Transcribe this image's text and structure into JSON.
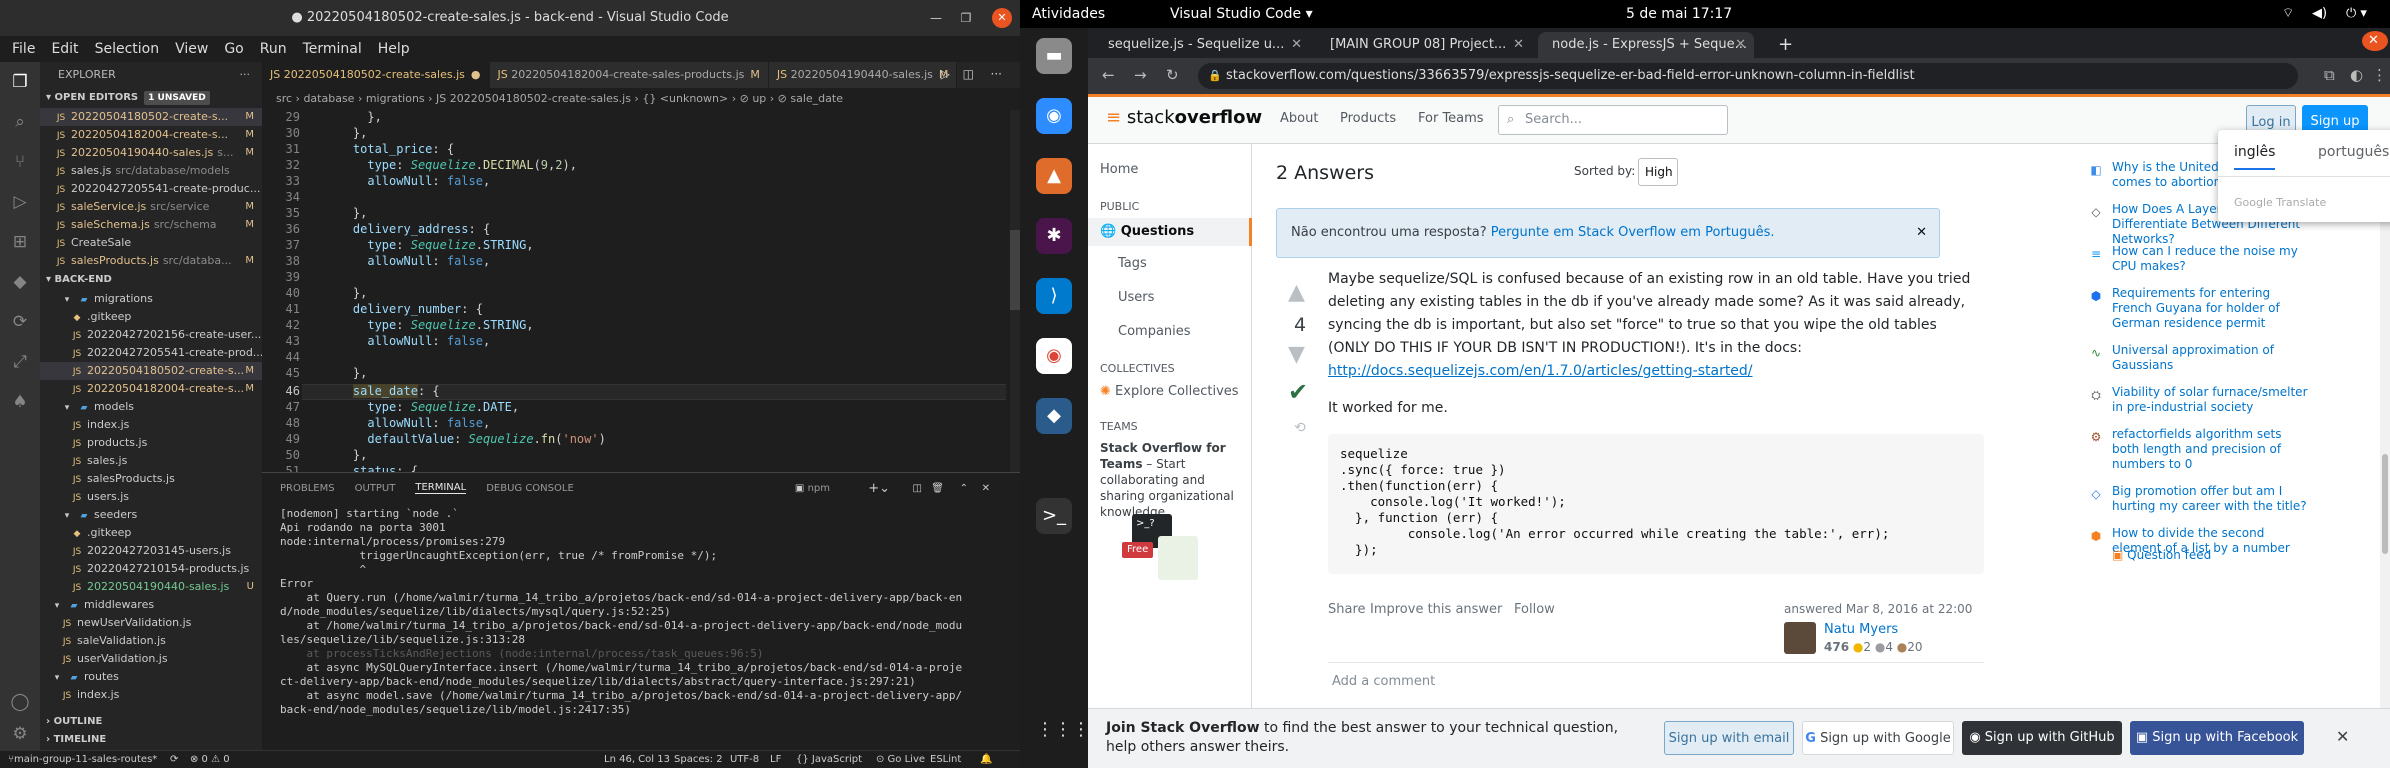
{
  "vscode": {
    "title": "● 20220504180502-create-sales.js - back-end - Visual Studio Code",
    "menu": [
      "File",
      "Edit",
      "Selection",
      "View",
      "Go",
      "Run",
      "Terminal",
      "Help"
    ],
    "explorer_label": "EXPLORER",
    "open_editors": {
      "label": "OPEN EDITORS",
      "badge": "1 UNSAVED",
      "files": [
        {
          "name": "20220504180502-create-s...",
          "path": "",
          "mark": "M"
        },
        {
          "name": "20220504182004-create-s...",
          "path": "",
          "mark": "M"
        },
        {
          "name": "20220504190440-sales.js",
          "path": "s...",
          "mark": "M"
        },
        {
          "name": "sales.js",
          "path": "src/database/models",
          "mark": ""
        },
        {
          "name": "20220427205541-create-produc...",
          "path": "",
          "mark": ""
        },
        {
          "name": "saleService.js",
          "path": "src/service",
          "mark": "M"
        },
        {
          "name": "saleSchema.js",
          "path": "src/schema",
          "mark": "M"
        },
        {
          "name": "CreateSale",
          "path": "",
          "mark": ""
        },
        {
          "name": "salesProducts.js",
          "path": "src/databa...",
          "mark": "M"
        }
      ]
    },
    "project": {
      "label": "BACK-END",
      "tree": [
        {
          "name": "migrations",
          "indent": 2,
          "folder": true
        },
        {
          "name": ".gitkeep",
          "indent": 3
        },
        {
          "name": "20220427202156-create-user...",
          "indent": 3
        },
        {
          "name": "20220427205541-create-prod...",
          "indent": 3
        },
        {
          "name": "20220504180502-create-s...",
          "indent": 3,
          "mark": "M"
        },
        {
          "name": "20220504182004-create-s...",
          "indent": 3,
          "mark": "M"
        },
        {
          "name": "models",
          "indent": 2,
          "folder": true
        },
        {
          "name": "index.js",
          "indent": 3
        },
        {
          "name": "products.js",
          "indent": 3
        },
        {
          "name": "sales.js",
          "indent": 3
        },
        {
          "name": "salesProducts.js",
          "indent": 3
        },
        {
          "name": "users.js",
          "indent": 3
        },
        {
          "name": "seeders",
          "indent": 2,
          "folder": true
        },
        {
          "name": ".gitkeep",
          "indent": 3
        },
        {
          "name": "20220427203145-users.js",
          "indent": 3
        },
        {
          "name": "20220427210154-products.js",
          "indent": 3
        },
        {
          "name": "20220504190440-sales.js",
          "indent": 3,
          "mark": "U"
        },
        {
          "name": "middlewares",
          "indent": 1,
          "folder": true
        },
        {
          "name": "newUserValidation.js",
          "indent": 2
        },
        {
          "name": "saleValidation.js",
          "indent": 2
        },
        {
          "name": "userValidation.js",
          "indent": 2
        },
        {
          "name": "routes",
          "indent": 1,
          "folder": true
        },
        {
          "name": "index.js",
          "indent": 2
        }
      ]
    },
    "outline": "OUTLINE",
    "timeline": "TIMELINE",
    "tabs": [
      {
        "name": "20220504180502-create-sales.js",
        "mark": "●"
      },
      {
        "name": "20220504182004-create-sales-products.js",
        "mark": "M"
      },
      {
        "name": "20220504190440-sales.js",
        "mark": "M"
      }
    ],
    "breadcrumb": "src › database › migrations › JS 20220504180502-create-sales.js › {} <unknown> › ⊘ up › ⊘ sale_date",
    "code_lines": [
      "29",
      "30",
      "31",
      "32",
      "33",
      "34",
      "35",
      "36",
      "37",
      "38",
      "39",
      "40",
      "41",
      "42",
      "43",
      "44",
      "45",
      "46",
      "47",
      "48",
      "49",
      "50",
      "51"
    ],
    "panel_tabs": [
      "PROBLEMS",
      "OUTPUT",
      "TERMINAL",
      "DEBUG CONSOLE"
    ],
    "terminal_task": "npm",
    "terminal": [
      "[nodemon] starting `node .`",
      "Api rodando na porta 3001",
      "node:internal/process/promises:279",
      "            triggerUncaughtException(err, true /* fromPromise */);",
      "            ^",
      "",
      "Error",
      "    at Query.run (/home/walmir/turma_14_tribo_a/projetos/back-end/sd-014-a-project-delivery-app/back-en",
      "d/node_modules/sequelize/lib/dialects/mysql/query.js:52:25)",
      "    at /home/walmir/turma_14_tribo_a/projetos/back-end/sd-014-a-project-delivery-app/back-end/node_modu",
      "les/sequelize/lib/sequelize.js:313:28",
      "    at processTicksAndRejections (node:internal/process/task_queues:96:5)",
      "    at async MySQLQueryInterface.insert (/home/walmir/turma_14_tribo_a/projetos/back-end/sd-014-a-proje",
      "ct-delivery-app/back-end/node_modules/sequelize/lib/dialects/abstract/query-interface.js:297:21)",
      "    at async model.save (/home/walmir/turma_14_tribo_a/projetos/back-end/sd-014-a-project-delivery-app/",
      "back-end/node_modules/sequelize/lib/model.js:2417:35)"
    ],
    "status": {
      "branch": "main-group-11-sales-routes*",
      "sync": "⟳",
      "errors": "⊗ 0 ⚠ 0",
      "pos": "Ln 46, Col 13",
      "spaces": "Spaces: 2",
      "enc": "UTF-8",
      "eol": "LF",
      "lang": "{} JavaScript",
      "golive": "⊙ Go Live",
      "eslint": "ESLint"
    }
  },
  "gnome": {
    "activities": "Atividades",
    "app": "Visual Studio Code ▾",
    "clock": "5 de mai  17:17"
  },
  "chrome": {
    "tabs": [
      "sequelize.js - Sequelize u...",
      "[MAIN GROUP 08] Project...",
      "node.js - ExpressJS + Seque..."
    ],
    "url": "stackoverflow.com/questions/33663579/expressjs-sequelize-er-bad-field-error-unknown-column-in-fieldlist",
    "translate": {
      "lang1": "inglês",
      "lang2": "português",
      "footer": "Google Translate"
    }
  },
  "so": {
    "logo_a": "stack",
    "logo_b": "overflow",
    "nav": [
      "About",
      "Products",
      "For Teams"
    ],
    "search_placeholder": "Search...",
    "login": "Log in",
    "signup": "Sign up",
    "side": {
      "home": "Home",
      "public": "PUBLIC",
      "questions": "Questions",
      "tags": "Tags",
      "users": "Users",
      "companies": "Companies",
      "collectives": "COLLECTIVES",
      "explore": "Explore Collectives",
      "teams": "TEAMS",
      "teams_title": "Stack Overflow for Teams",
      "teams_desc": " – Start collaborating and sharing organizational knowledge.",
      "free": "Free"
    },
    "answers_count": "2 Answers",
    "sorted_by": "Sorted by:",
    "sorted_value": "High",
    "notice_text": "Não encontrou uma resposta? ",
    "notice_link": "Pergunte em Stack Overflow em Português.",
    "vote": "4",
    "answer_p1": "Maybe sequelize/SQL is confused because of an existing row in an old table. Have you tried deleting any existing tables in the db if you've already made some? As it was said already, syncing the db is important, but also set \"force\" to true so that you wipe the old tables (ONLY DO THIS IF YOUR DB ISN'T IN PRODUCTION!). It's in the docs:",
    "answer_link": "http://docs.sequelizejs.com/en/1.7.0/articles/getting-started/",
    "answer_p2": "It worked for me.",
    "code": "sequelize\n.sync({ force: true })\n.then(function(err) {\n    console.log('It worked!');\n  }, function (err) {\n         console.log('An error occurred while creating the table:', err);\n  });",
    "share": "Share",
    "improve": "Improve this answer",
    "follow": "Follow",
    "answered": "answered Mar 8, 2016 at 22:00",
    "user": "Natu Myers",
    "rep": "476",
    "gold": "2",
    "silver": "4",
    "bronze": "20",
    "add_comment": "Add a comment",
    "hot": [
      "Why is the United States ... comes to abortion laws?",
      "How Does A Layer 2 Switch Differentiate Between Different Networks?",
      "How can I reduce the noise my CPU makes?",
      "Requirements for entering French Guyana for holder of German residence permit",
      "Universal approximation of Gaussians",
      "Viability of solar furnace/smelter in pre-industrial society",
      "refactorfields algorithm sets both length and precision of numbers to 0",
      "Big promotion offer but am I hurting my career with the title?",
      "How to divide the second element of a list by a number"
    ],
    "feed": "Question feed",
    "join_title": "Join Stack Overflow",
    "join_text": " to find the best answer to your technical question, help others answer theirs.",
    "btn_email": "Sign up with email",
    "btn_google": "Sign up with Google",
    "btn_github": "Sign up with GitHub",
    "btn_fb": "Sign up with Facebook"
  }
}
